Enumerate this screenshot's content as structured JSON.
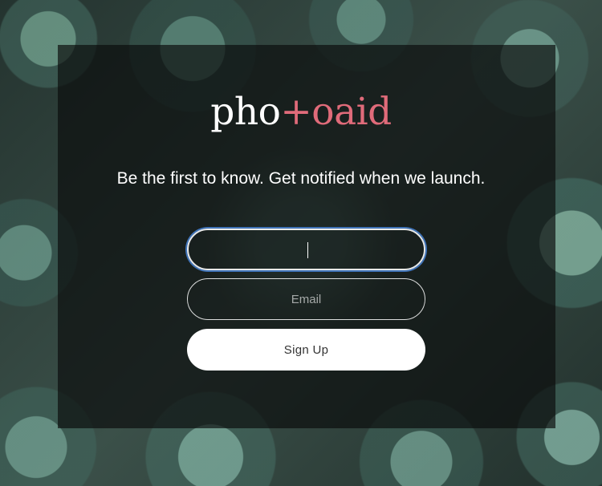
{
  "brand": {
    "part1": "pho",
    "part2": "+o",
    "part3": "aid"
  },
  "tagline": "Be the first to know. Get notified when we launch.",
  "form": {
    "name_value": "",
    "email_placeholder": "Email",
    "signup_label": "Sign Up"
  },
  "colors": {
    "brand_accent": "#e06b7a",
    "focus_ring": "#3f73b8",
    "overlay": "rgba(10,12,12,0.68)"
  }
}
